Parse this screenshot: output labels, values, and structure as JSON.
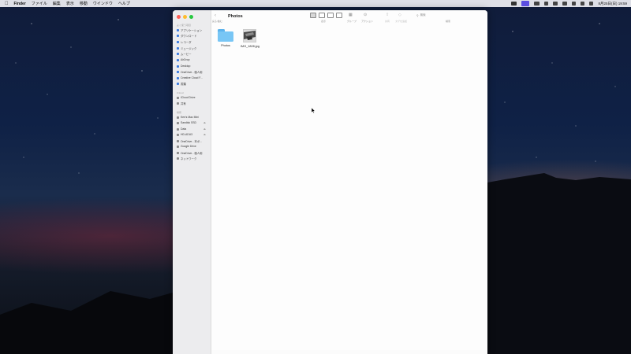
{
  "menubar": {
    "apple": "",
    "app": "Finder",
    "menus": [
      "ファイル",
      "編集",
      "表示",
      "移動",
      "ウインドウ",
      "ヘルプ"
    ],
    "clock": "8月25日(日) 19:59",
    "accent_color": "#5b4ee0"
  },
  "window": {
    "title": "Photos",
    "nav_label": "戻る/進む",
    "toolbar": {
      "view_label": "表示",
      "group_label": "グループ",
      "action_label": "アクション",
      "share_label": "共有",
      "tag_label": "タグを追加",
      "search_label": "検索",
      "search_placeholder": "検索",
      "icons": [
        "back-icon",
        "forward-icon",
        "icon-view-icon",
        "list-view-icon",
        "column-view-icon",
        "gallery-view-icon",
        "group-icon",
        "action-icon",
        "share-icon",
        "tag-icon",
        "search-icon"
      ]
    },
    "sidebar": {
      "favorites_header": "よく使う項目",
      "favorites": [
        {
          "label": "アプリケーション",
          "icon": "apps-icon"
        },
        {
          "label": "ダウンロード",
          "icon": "download-icon"
        },
        {
          "label": "レコーダ",
          "icon": "recorder-icon"
        },
        {
          "label": "ミュージック",
          "icon": "music-icon"
        },
        {
          "label": "ムービー",
          "icon": "movie-icon"
        },
        {
          "label": "AirDrop",
          "icon": "airdrop-icon"
        },
        {
          "label": "Desktop",
          "icon": "desktop-icon"
        },
        {
          "label": "OneDrive - 個人用",
          "icon": "cloud-icon"
        },
        {
          "label": "Creative Cloud F...",
          "icon": "creative-cloud-icon"
        },
        {
          "label": "書類",
          "icon": "document-icon"
        }
      ],
      "icloud_header": "iCloud",
      "icloud": [
        {
          "label": "iCloud Drive",
          "icon": "icloud-icon"
        },
        {
          "label": "共有",
          "icon": "shared-icon"
        }
      ],
      "locations_header": "場所",
      "locations": [
        {
          "label": "Ken's Mac Mini",
          "icon": "computer-icon",
          "eject": ""
        },
        {
          "label": "Sandisk SSD",
          "icon": "drive-icon",
          "eject": "⏏"
        },
        {
          "label": "Data",
          "icon": "drive-icon",
          "eject": "⏏"
        },
        {
          "label": "HD-ADU3",
          "icon": "drive-icon",
          "eject": "⏏"
        },
        {
          "label": "OneDrive - 本ボ...",
          "icon": "cloud-icon",
          "eject": ""
        },
        {
          "label": "Google Drive",
          "icon": "google-drive-icon",
          "eject": ""
        },
        {
          "label": "OneDrive - 個人用",
          "icon": "cloud-icon",
          "eject": ""
        },
        {
          "label": "ネットワーク",
          "icon": "network-icon",
          "eject": ""
        }
      ]
    },
    "files": [
      {
        "name": "Photos",
        "kind": "folder"
      },
      {
        "name": "IMG_1828.jpg",
        "kind": "image"
      }
    ]
  }
}
